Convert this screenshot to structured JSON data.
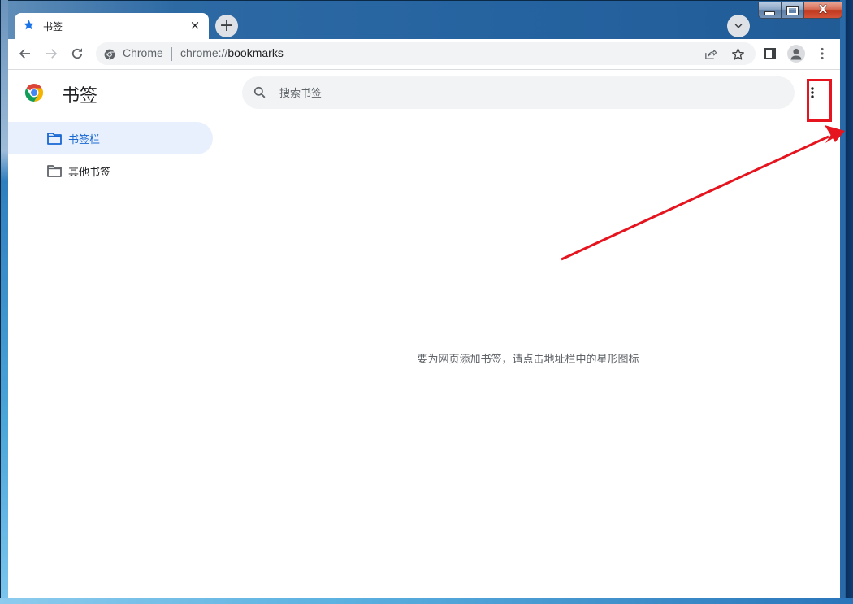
{
  "window": {
    "caption_buttons": [
      "minimize",
      "maximize",
      "close"
    ]
  },
  "tab": {
    "title": "书签",
    "icon": "star-icon",
    "close_glyph": "×"
  },
  "new_tab_glyph": "+",
  "toolbar": {
    "omnibox_chip": "Chrome",
    "url_scheme": "chrome://",
    "url_rest": "bookmarks"
  },
  "page": {
    "title": "书签",
    "search_placeholder": "搜索书签",
    "sidebar": [
      {
        "label": "书签栏",
        "active": true
      },
      {
        "label": "其他书签",
        "active": false
      }
    ],
    "empty_message": "要为网页添加书签，请点击地址栏中的星形图标"
  },
  "colors": {
    "accent": "#1a73e8",
    "active_item_bg": "#e8f0fe",
    "annotation_red": "#e5141e"
  },
  "annotation": {
    "type": "red-box-with-arrow",
    "target": "more-options-menu-button"
  }
}
